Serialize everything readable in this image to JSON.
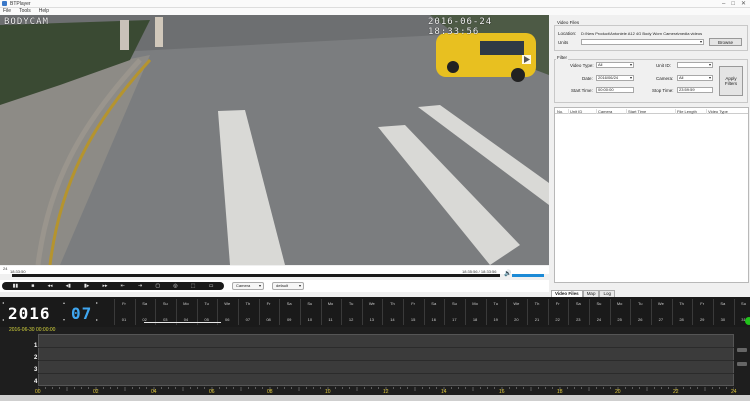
{
  "window": {
    "title": "BTPlayer",
    "controls": [
      "–",
      "□",
      "✕"
    ]
  },
  "menu": [
    "File",
    "Tools",
    "Help"
  ],
  "video": {
    "osd_brand": "BODYCAM",
    "osd_timestamp": "2016-06-24 18:33:56"
  },
  "player": {
    "left_time_top": "24",
    "left_time": "18:33:50",
    "right_time": "18:35:56 / 18:33:56",
    "transport_buttons": [
      "▮▮",
      "■",
      "◂◂",
      "◂▮",
      "▮▸",
      "▸▸",
      "⇤",
      "⇥",
      "▢",
      "◎",
      "⬚",
      "▭"
    ],
    "camera_select": "Camera",
    "speed_select": "default"
  },
  "panel": {
    "video_files_group": "Video Files",
    "location_label": "Location:",
    "location_value": "D:\\New Product\\Antoniele A12 4G Body Worn Camera\\media videos",
    "unit_label": "Units",
    "browse_button": "Browse",
    "filter_group": "Filter",
    "video_type_label": "Video Type:",
    "video_type_value": "All",
    "unit_id_label": "Unit ID:",
    "unit_id_value": "",
    "date_label": "Date:",
    "date_value": "2016/06/24",
    "camera_label": "Camera:",
    "camera_value": "All",
    "start_time_label": "Start Time:",
    "start_time_value": "00:00:00",
    "stop_time_label": "Stop Time:",
    "stop_time_value": "23:59:59",
    "apply_filters_button": "Apply Filters",
    "table_columns": [
      "No.",
      "Unit ID",
      "Camera",
      "Start Time",
      "File Length",
      "Video Type"
    ],
    "tabs": [
      "Video Files",
      "Map",
      "Log"
    ]
  },
  "calendar": {
    "year": "2016",
    "month": "07",
    "weekdays": [
      "Fr",
      "Sa",
      "Su",
      "Mo",
      "Tu",
      "We",
      "Th",
      "Fr",
      "Sa",
      "Su",
      "Mo",
      "Tu",
      "We",
      "Th",
      "Fr",
      "Sa",
      "Su",
      "Mo",
      "Tu",
      "We",
      "Th",
      "Fr",
      "Sa",
      "Su",
      "Mo",
      "Tu",
      "We",
      "Th",
      "Fr",
      "Sa",
      "Su"
    ],
    "days": [
      "01",
      "02",
      "03",
      "04",
      "05",
      "06",
      "07",
      "08",
      "09",
      "10",
      "11",
      "12",
      "13",
      "14",
      "15",
      "16",
      "17",
      "18",
      "19",
      "20",
      "21",
      "22",
      "23",
      "24",
      "25",
      "26",
      "27",
      "28",
      "29",
      "30",
      "31"
    ]
  },
  "timeline": {
    "date_label": "2016-06-30 00:00:00",
    "channels": [
      "1",
      "2",
      "3",
      "4"
    ],
    "hours": [
      "00",
      "02",
      "04",
      "06",
      "08",
      "10",
      "12",
      "14",
      "16",
      "18",
      "20",
      "22",
      "24"
    ]
  },
  "colors": {
    "accent_blue": "#1c8ad6",
    "timeline_yellow": "#e0c93a",
    "online_green": "#21c21b"
  }
}
